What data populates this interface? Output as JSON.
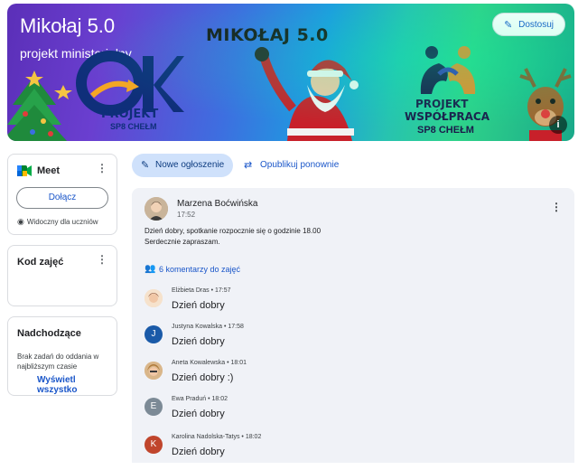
{
  "banner": {
    "class_title": "Mikołaj 5.0",
    "class_subtitle": "projekt ministerialny",
    "heading": "MIKOŁAJ 5.0",
    "customize_label": "Dostosuj",
    "ok_logo_text": "PROJEKT",
    "ok_logo_sub": "SP8 CHEŁM",
    "pw_logo_line1": "PROJEKT",
    "pw_logo_line2": "WSPÓŁPRACA",
    "pw_logo_line3": "SP8 CHEŁM",
    "info_label": "i"
  },
  "sidebar": {
    "meet": {
      "title": "Meet",
      "join_label": "Dołącz",
      "visibility_text": "Widoczny dla uczniów"
    },
    "class_code": {
      "title": "Kod zajęć"
    },
    "upcoming": {
      "title": "Nadchodzące",
      "empty_text": "Brak zadań do oddania w najbliższym czasie",
      "view_all_label": "Wyświetl wszystko"
    }
  },
  "actions": {
    "new_announcement_label": "Nowe ogłoszenie",
    "repost_label": "Opublikuj ponownie"
  },
  "post": {
    "author": "Marzena Boćwińska",
    "time": "17:52",
    "body_line1": "Dzień dobry, spotkanie rozpocznie się o godzinie 18.00",
    "body_line2": "Serdecznie zapraszam.",
    "comments_label": "6 komentarzy do zajęć",
    "comments": [
      {
        "author": "Elżbieta Dras",
        "time": "17:57",
        "text": "Dzień dobry",
        "initial": "",
        "color": "#f4d7b8"
      },
      {
        "author": "Justyna Kowalska",
        "time": "17:58",
        "text": "Dzień dobry",
        "initial": "J",
        "color": "#1a5aa8"
      },
      {
        "author": "Aneta Kowalewska",
        "time": "18:01",
        "text": "Dzień dobry :)",
        "initial": "",
        "color": "#e7c49a"
      },
      {
        "author": "Ewa Praduń",
        "time": "18:02",
        "text": "Dzień dobry",
        "initial": "E",
        "color": "#7c8a96"
      },
      {
        "author": "Karolina Nadolska-Tatys",
        "time": "18:02",
        "text": "Dzień dobry",
        "initial": "K",
        "color": "#c0452c"
      }
    ]
  },
  "icons": {
    "customize": "pencil-icon",
    "new_announcement": "pencil-icon",
    "repost": "repost-icon",
    "comments": "people-icon",
    "visibility": "eye-icon",
    "meet": "meet-camera-icon",
    "info": "info-icon",
    "more": "more-vert-icon"
  },
  "colors": {
    "accent": "#1a56c9",
    "new_announcement_bg": "#cfe1fb",
    "post_bg": "#f0f2f7"
  }
}
